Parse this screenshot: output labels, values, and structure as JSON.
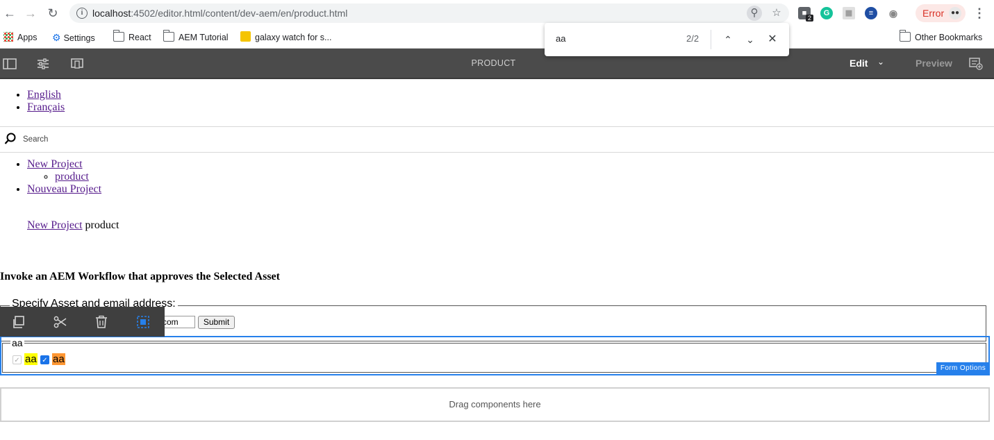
{
  "browser": {
    "url_host": "localhost",
    "url_rest": ":4502/editor.html/content/dev-aem/en/product.html",
    "error_label": "Error",
    "extension_badge": "2"
  },
  "bookmarks": {
    "items": [
      "Apps",
      "Settings",
      "React",
      "AEM Tutorial",
      "galaxy watch for s..."
    ],
    "other": "Other Bookmarks"
  },
  "findbar": {
    "query": "aa",
    "count": "2/2"
  },
  "aem": {
    "page_title": "PRODUCT",
    "edit_label": "Edit",
    "preview_label": "Preview"
  },
  "page": {
    "languages": [
      "English",
      "Français"
    ],
    "search_placeholder": "Search",
    "nav": {
      "project": "New Project",
      "child": "product",
      "project_fr": "Nouveau Project"
    },
    "breadcrumb": {
      "parent": "New Project",
      "current": "product"
    },
    "heading": "Invoke an AEM Workflow that approves the Selected Asset",
    "form": {
      "legend": "Specify Asset and email address:",
      "email_tail": "com",
      "submit_label": "Submit",
      "checkbox_legend": "aa",
      "option1": "aa",
      "option2": "aa",
      "form_options_label": "Form Options"
    },
    "dropzone_label": "Drag components here"
  },
  "colors": {
    "aem_bar": "#4b4b4b",
    "selection_blue": "#2680eb",
    "highlight_match": "#ffff00",
    "highlight_active": "#ff9632",
    "link_visited": "#551a8b"
  }
}
